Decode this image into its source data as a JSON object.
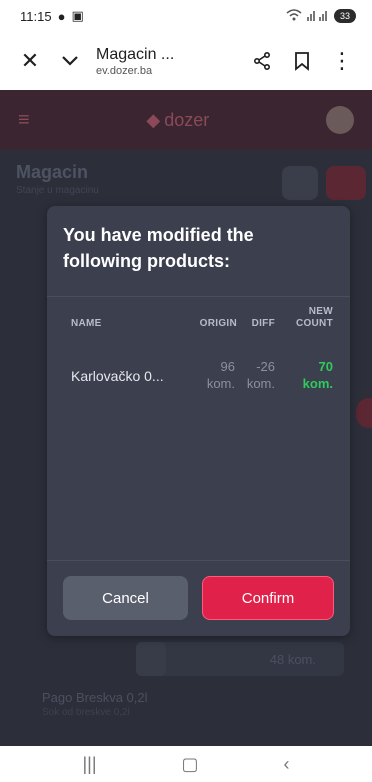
{
  "status_bar": {
    "time": "11:15",
    "battery": "33"
  },
  "browser": {
    "title": "Magacin ...",
    "url": "ev.dozer.ba"
  },
  "app": {
    "logo_text": "dozer",
    "page_title": "Magacin",
    "page_subtitle": "Stanje u magacinu",
    "quantity_value": "48 kom.",
    "list_item_name": "Pago Breskva 0,2l",
    "list_item_sub": "Sok od breskve 0,2l"
  },
  "modal": {
    "title": "You have modified the following products:",
    "columns": {
      "name": "NAME",
      "origin": "ORIGIN",
      "diff": "DIFF",
      "new_line1": "NEW",
      "new_line2": "COUNT"
    },
    "rows": [
      {
        "name": "Karlovačko 0...",
        "origin_value": "96",
        "origin_unit": "kom.",
        "diff_value": "-26",
        "diff_unit": "kom.",
        "new_value": "70",
        "new_unit": "kom."
      }
    ],
    "cancel_label": "Cancel",
    "confirm_label": "Confirm"
  },
  "colors": {
    "confirm": "#e0224a",
    "new_count": "#2ecc5a",
    "modal_bg": "#3b3f4e"
  }
}
